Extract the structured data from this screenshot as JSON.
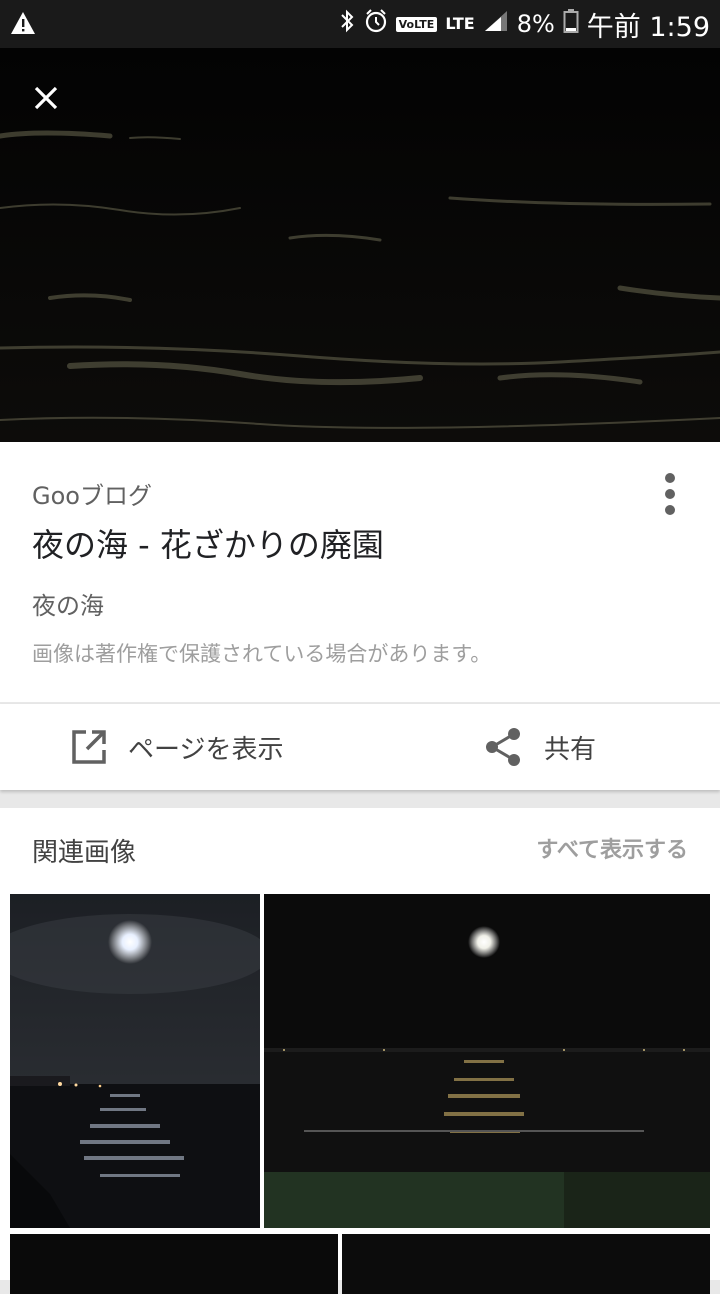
{
  "status_bar": {
    "battery": "8%",
    "time": "午前 1:59",
    "network": "LTE",
    "volte": "VoLTE"
  },
  "icons": {
    "warning": "warning-icon",
    "bluetooth": "bluetooth-icon",
    "alarm": "alarm-icon",
    "signal": "signal-icon",
    "battery": "battery-icon",
    "close": "close-icon",
    "more": "more-vert-icon",
    "open_in_new": "open-in-new-icon",
    "share": "share-icon"
  },
  "image_detail": {
    "source": "Gooブログ",
    "title": "夜の海 - 花ざかりの廃園",
    "subtitle": "夜の海",
    "copyright_notice": "画像は著作権で保護されている場合があります。"
  },
  "actions": {
    "visit_label": "ページを表示",
    "share_label": "共有"
  },
  "related": {
    "title": "関連画像",
    "see_all": "すべて表示する"
  },
  "colors": {
    "status_bar": "#1a1a1a",
    "card": "#ffffff",
    "background": "#e8e8e8",
    "text_primary": "#202124",
    "text_secondary": "#616161",
    "text_muted": "#9e9e9e"
  }
}
